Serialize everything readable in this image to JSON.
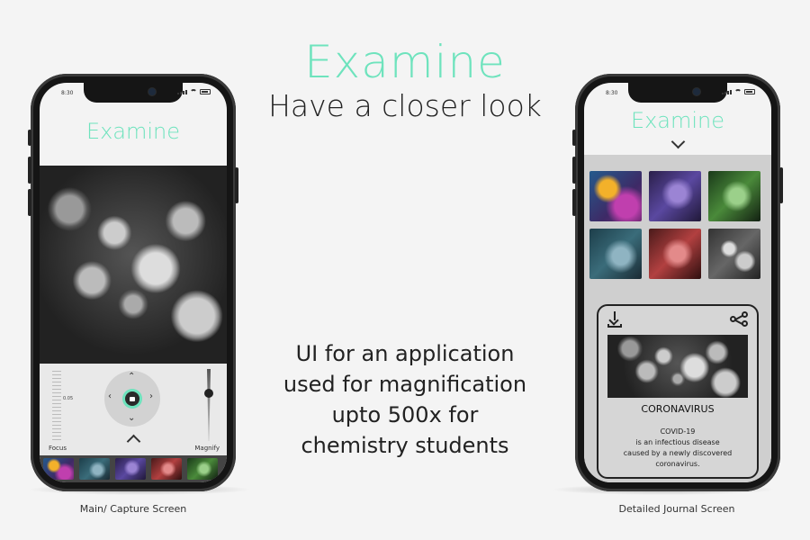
{
  "hero": {
    "title": "Examine",
    "subtitle": "Have a closer look"
  },
  "description": {
    "lines": [
      "UI for an application",
      "used for magnification",
      "upto 500x for",
      "chemistry students"
    ]
  },
  "left_phone": {
    "status_time": "8:30",
    "app_title": "Examine",
    "focus_label": "Focus",
    "focus_value": "0.05",
    "magnify_label": "Magnify",
    "strip_thumbs": [
      "t-yellow",
      "t-teal",
      "t-purple",
      "t-red",
      "t-green"
    ],
    "caption": "Main/ Capture Screen"
  },
  "right_phone": {
    "status_time": "8:30",
    "app_title": "Examine",
    "grid_thumbs": [
      "t-yellow",
      "t-purple",
      "t-green",
      "t-teal",
      "t-red",
      "t-gray"
    ],
    "card": {
      "title": "CORONAVIRUS",
      "text_lines": [
        "COVID-19",
        "is an infectious disease",
        "caused by a newly discovered",
        "coronavirus."
      ]
    },
    "caption": "Detailed Journal Screen"
  },
  "icons": {
    "camera": "camera-icon",
    "download": "download-icon",
    "share": "share-icon",
    "chevron_up": "chevron-up-icon",
    "chevron_down": "chevron-down-icon"
  },
  "colors": {
    "accent": "#6ee3bd",
    "background": "#f4f4f4",
    "phone_body": "#151515"
  }
}
